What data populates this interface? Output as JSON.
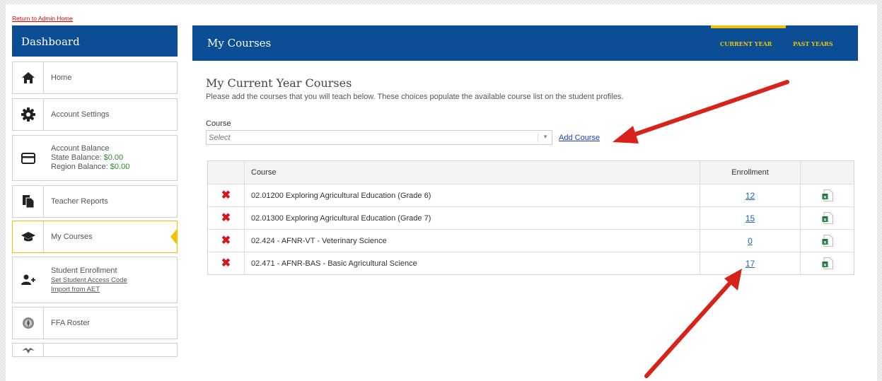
{
  "return_link": "Return to Admin Home",
  "sidebar": {
    "title": "Dashboard",
    "items": [
      {
        "label": "Home",
        "icon": "home-icon"
      },
      {
        "label": "Account Settings",
        "icon": "gear-icon"
      },
      {
        "label": "Account Balance",
        "icon": "credit-card-icon",
        "state_label": "State Balance: ",
        "state_value": "$0.00",
        "region_label": "Region Balance: ",
        "region_value": "$0.00"
      },
      {
        "label": "Teacher Reports",
        "icon": "reports-icon"
      },
      {
        "label": "My Courses",
        "icon": "graduation-cap-icon"
      },
      {
        "label": "Student Enrollment",
        "icon": "add-user-icon",
        "links": [
          "Set Student Access Code",
          "Import from AET"
        ]
      },
      {
        "label": "FFA Roster",
        "icon": "ffa-emblem-icon"
      }
    ]
  },
  "main": {
    "title": "My Courses",
    "tabs": [
      {
        "label": "CURRENT YEAR",
        "active": true
      },
      {
        "label": "PAST YEARS",
        "active": false
      }
    ],
    "section_title": "My Current Year Courses",
    "section_desc": "Please add the courses that you will teach below. These choices populate the available course list on the student profiles.",
    "course_label": "Course",
    "course_select_placeholder": "Select",
    "add_course_label": "Add Course"
  },
  "table": {
    "columns": [
      "",
      "Course",
      "Enrollment",
      ""
    ],
    "rows": [
      {
        "course": "02.01200 Exploring Agricultural Education (Grade 6)",
        "enrollment": "12"
      },
      {
        "course": "02.01300 Exploring Agricultural Education (Grade 7)",
        "enrollment": "15"
      },
      {
        "course": "02.424 - AFNR-VT - Veterinary Science",
        "enrollment": "0"
      },
      {
        "course": "02.471 - AFNR-BAS - Basic Agricultural Science",
        "enrollment": "17"
      }
    ]
  },
  "colors": {
    "brand_blue": "#0b4e96",
    "accent_gold": "#f2c200",
    "delete_red": "#d9141b",
    "annotation_red": "#d8231b"
  }
}
